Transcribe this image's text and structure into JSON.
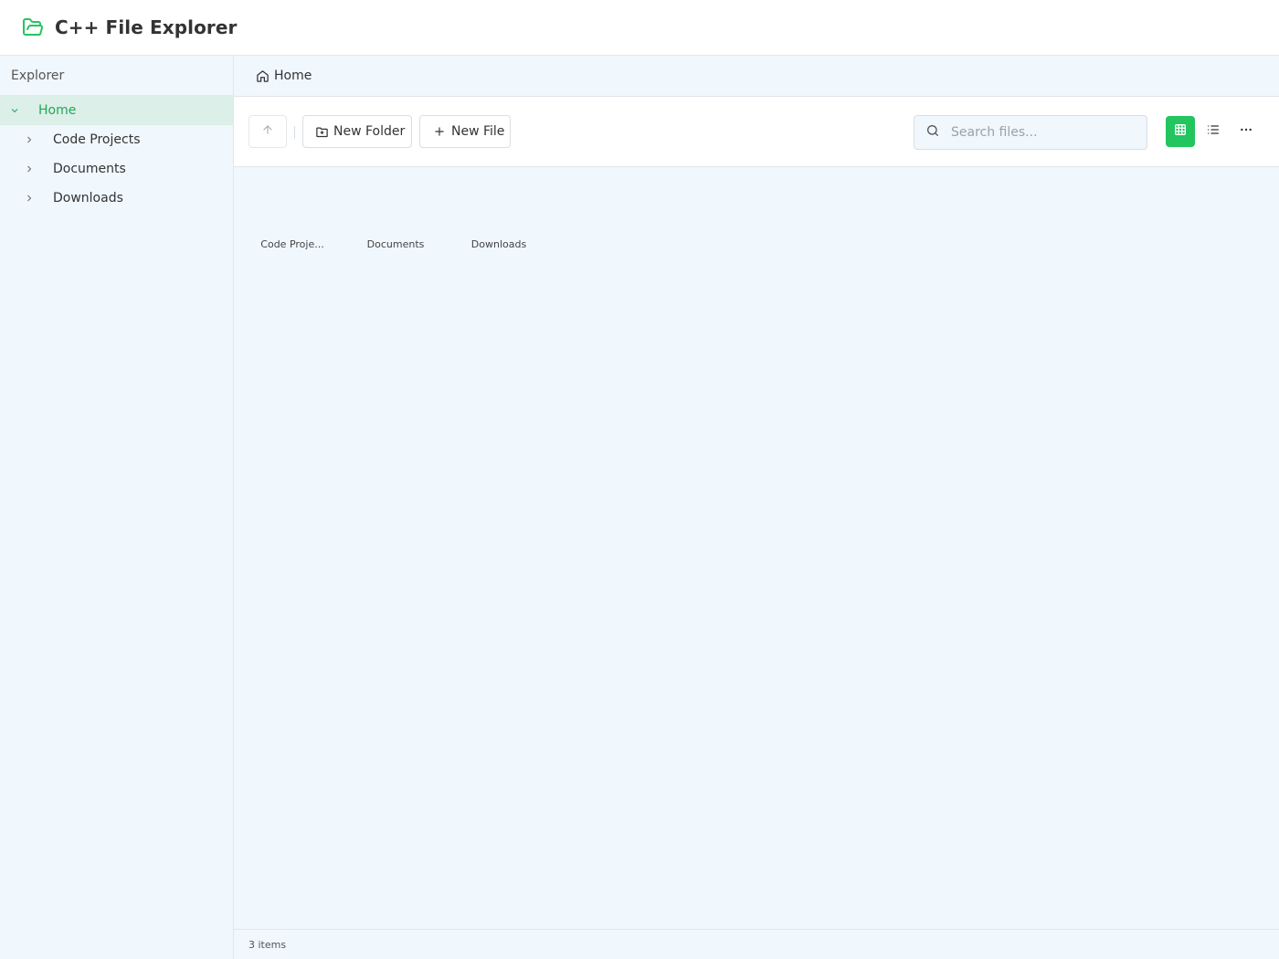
{
  "app": {
    "title": "C++ File Explorer",
    "accent_color": "#22c55e",
    "logo_icon": "folder-open-icon"
  },
  "sidebar": {
    "title": "Explorer",
    "items": [
      {
        "label": "Home",
        "glyph": "",
        "expanded": true,
        "active": true
      },
      {
        "label": "Code Projects",
        "glyph": "",
        "expanded": false,
        "active": false
      },
      {
        "label": "Documents",
        "glyph": "",
        "expanded": false,
        "active": false
      },
      {
        "label": "Downloads",
        "glyph": "",
        "expanded": false,
        "active": false
      }
    ]
  },
  "breadcrumb": {
    "icon": "home-icon",
    "items": [
      "Home"
    ]
  },
  "toolbar": {
    "up_icon": "arrow-up-icon",
    "new_folder_label": "New Folder",
    "new_file_label": "New File",
    "search_placeholder": "Search files...",
    "search_value": "",
    "view_mode": "grid"
  },
  "files": [
    {
      "name": "Code Projects",
      "display": "Code Proje...",
      "glyph": ""
    },
    {
      "name": "Documents",
      "display": "Documents",
      "glyph": ""
    },
    {
      "name": "Downloads",
      "display": "Downloads",
      "glyph": ""
    }
  ],
  "status": {
    "count_text": "3 items"
  }
}
